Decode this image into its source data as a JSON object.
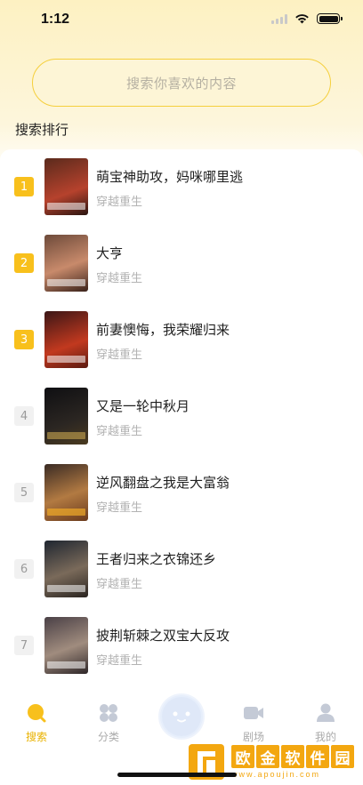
{
  "status": {
    "time": "1:12"
  },
  "search": {
    "placeholder": "搜索你喜欢的内容"
  },
  "section": {
    "title": "搜索排行"
  },
  "ranking": [
    {
      "rank": "1",
      "title": "萌宝神助攻，妈咪哪里逃",
      "tag": "穿越重生",
      "top": true,
      "colors": [
        "#5a2a1c",
        "#b6422d"
      ]
    },
    {
      "rank": "2",
      "title": "大亨",
      "tag": "穿越重生",
      "top": true,
      "colors": [
        "#6d4a3a",
        "#c88a6b"
      ]
    },
    {
      "rank": "3",
      "title": "前妻懊悔，我荣耀归来",
      "tag": "穿越重生",
      "top": true,
      "colors": [
        "#3b1616",
        "#c2391f"
      ]
    },
    {
      "rank": "4",
      "title": "又是一轮中秋月",
      "tag": "穿越重生",
      "top": false,
      "colors": [
        "#0f0f12",
        "#2b2622"
      ]
    },
    {
      "rank": "5",
      "title": "逆风翻盘之我是大富翁",
      "tag": "穿越重生",
      "top": false,
      "colors": [
        "#3a2b24",
        "#b27a42"
      ]
    },
    {
      "rank": "6",
      "title": "王者归来之衣锦还乡",
      "tag": "穿越重生",
      "top": false,
      "colors": [
        "#1f2630",
        "#7a6a5a"
      ]
    },
    {
      "rank": "7",
      "title": "披荆斩棘之双宝大反攻",
      "tag": "穿越重生",
      "top": false,
      "colors": [
        "#4a4046",
        "#a08c7e"
      ]
    }
  ],
  "tabs": {
    "search": "搜索",
    "category": "分类",
    "theater": "剧场",
    "mine": "我的"
  },
  "watermark": {
    "chars": [
      "欧",
      "金",
      "软",
      "件",
      "园"
    ],
    "url": "www.apoujin.com"
  },
  "colors": {
    "accent": "#f8c01c",
    "tab_active": "#e9b200",
    "tab_inactive": "#aaaaaa"
  }
}
